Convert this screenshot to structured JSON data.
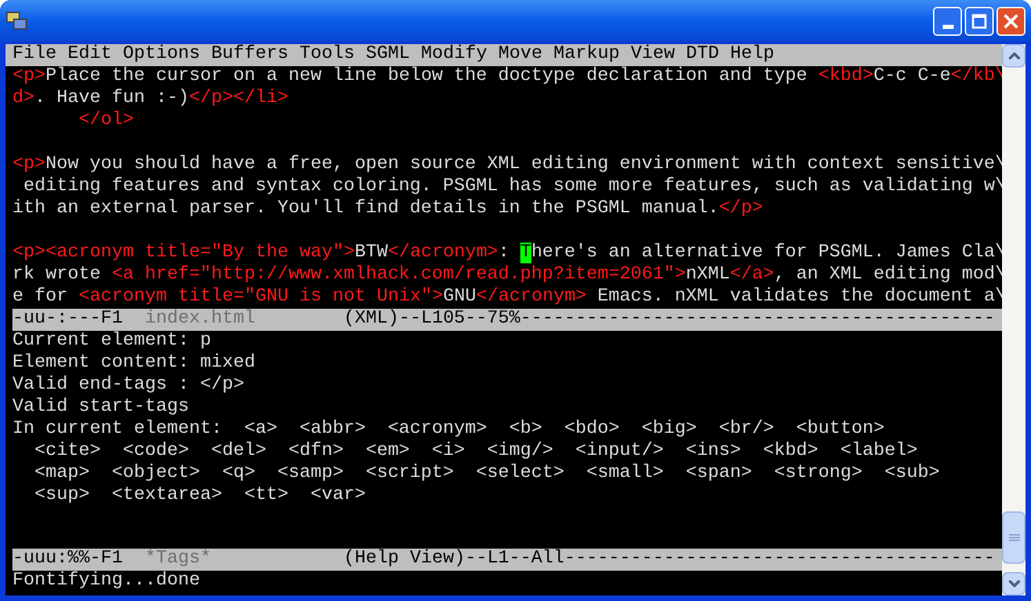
{
  "menu": [
    "File",
    "Edit",
    "Options",
    "Buffers",
    "Tools",
    "SGML",
    "Modify",
    "Move",
    "Markup",
    "View",
    "DTD",
    "Help"
  ],
  "editor": {
    "paragraphs": [
      [
        [
          {
            "kind": "tag",
            "text": "<p>"
          },
          {
            "kind": "text",
            "text": "Place the cursor on a new line below the doctype declaration and type "
          },
          {
            "kind": "tag",
            "text": "<kbd>"
          },
          {
            "kind": "text",
            "text": "C-c C-e"
          },
          {
            "kind": "tag",
            "text": "</kb\\"
          }
        ],
        [
          {
            "kind": "tag",
            "text": "d>"
          },
          {
            "kind": "text",
            "text": ". Have fun :-)"
          },
          {
            "kind": "tag",
            "text": "</p></li>"
          }
        ],
        [
          {
            "kind": "tag",
            "text": "      </ol>"
          }
        ]
      ],
      [
        [
          {
            "kind": "tag",
            "text": "<p>"
          },
          {
            "kind": "text",
            "text": "Now you should have a free, open source XML editing environment with context sensitive\\"
          }
        ],
        [
          {
            "kind": "text",
            "text": " editing features and syntax coloring. PSGML has some more features, such as validating w\\"
          }
        ],
        [
          {
            "kind": "text",
            "text": "ith an external parser. You'll find details in the PSGML manual."
          },
          {
            "kind": "tag",
            "text": "</p>"
          }
        ]
      ],
      [
        [
          {
            "kind": "tag",
            "text": "<p><acronym title=\"By the way\">"
          },
          {
            "kind": "text",
            "text": "BTW"
          },
          {
            "kind": "tag",
            "text": "</acronym>"
          },
          {
            "kind": "text",
            "text": ": "
          },
          {
            "kind": "cursor",
            "text": "T"
          },
          {
            "kind": "text",
            "text": "here's an alternative for PSGML. James Cla\\"
          }
        ],
        [
          {
            "kind": "text",
            "text": "rk wrote "
          },
          {
            "kind": "tag",
            "text": "<a href=\"http://www.xmlhack.com/read.php?item=2061\">"
          },
          {
            "kind": "text",
            "text": "nXML"
          },
          {
            "kind": "tag",
            "text": "</a>"
          },
          {
            "kind": "text",
            "text": ", an XML editing mod\\"
          }
        ],
        [
          {
            "kind": "text",
            "text": "e for "
          },
          {
            "kind": "tag",
            "text": "<acronym title=\"GNU is not Unix\">"
          },
          {
            "kind": "text",
            "text": "GNU"
          },
          {
            "kind": "tag",
            "text": "</acronym>"
          },
          {
            "kind": "text",
            "text": " Emacs. nXML validates the document a\\"
          }
        ]
      ]
    ],
    "mode_line": [
      {
        "kind": "text",
        "text": "-uu-:---F1  "
      },
      {
        "kind": "buffer",
        "text": "index.html"
      },
      {
        "kind": "text",
        "text": "        (XML)--L105--75%-------------------------------------------"
      }
    ]
  },
  "help": {
    "lines": [
      "Current element: p",
      "Element content: mixed",
      "Valid end-tags : </p>",
      "Valid start-tags",
      "In current element:  <a>  <abbr>  <acronym>  <b>  <bdo>  <big>  <br/>  <button>",
      "  <cite>  <code>  <del>  <dfn>  <em>  <i>  <img/>  <input/>  <ins>  <kbd>  <label>",
      "  <map>  <object>  <q>  <samp>  <script>  <select>  <small>  <span>  <strong>  <sub>",
      "  <sup>  <textarea>  <tt>  <var>"
    ],
    "mode_line": [
      {
        "kind": "text",
        "text": "-uuu:%%-F1  "
      },
      {
        "kind": "buffer",
        "text": "*Tags*"
      },
      {
        "kind": "text",
        "text": "            (Help View)--L1--All---------------------------------------"
      }
    ]
  },
  "minibuffer": "Fontifying...done"
}
